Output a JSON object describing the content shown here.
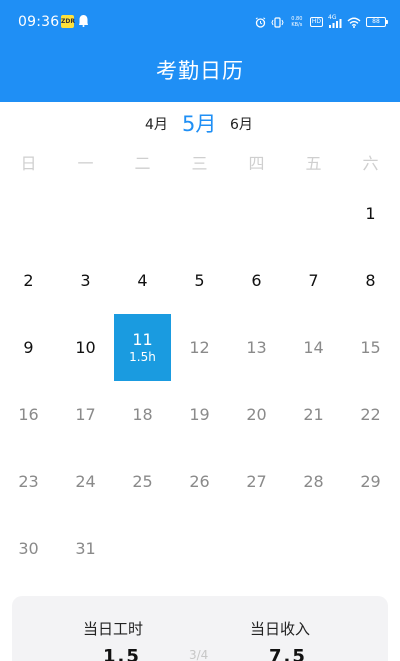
{
  "status_bar": {
    "time": "09:36",
    "notification_badge": "ZDR",
    "net_speed_line1": "0.80",
    "net_speed_line2": "KB/s",
    "hd": "HD",
    "network": "4G",
    "battery": "88"
  },
  "header": {
    "title": "考勤日历"
  },
  "month_nav": {
    "prev": "4月",
    "current": "5月",
    "next": "6月"
  },
  "weekdays": [
    "日",
    "一",
    "二",
    "三",
    "四",
    "五",
    "六"
  ],
  "calendar": {
    "days": [
      {
        "num": "1",
        "state": "past",
        "hours": ""
      },
      {
        "num": "2",
        "state": "past",
        "hours": ""
      },
      {
        "num": "3",
        "state": "past",
        "hours": ""
      },
      {
        "num": "4",
        "state": "past",
        "hours": ""
      },
      {
        "num": "5",
        "state": "past",
        "hours": ""
      },
      {
        "num": "6",
        "state": "past",
        "hours": ""
      },
      {
        "num": "7",
        "state": "past",
        "hours": ""
      },
      {
        "num": "8",
        "state": "past",
        "hours": ""
      },
      {
        "num": "9",
        "state": "past",
        "hours": ""
      },
      {
        "num": "10",
        "state": "past",
        "hours": ""
      },
      {
        "num": "11",
        "state": "selected",
        "hours": "1.5h"
      },
      {
        "num": "12",
        "state": "future",
        "hours": ""
      },
      {
        "num": "13",
        "state": "future",
        "hours": ""
      },
      {
        "num": "14",
        "state": "future",
        "hours": ""
      },
      {
        "num": "15",
        "state": "future",
        "hours": ""
      },
      {
        "num": "16",
        "state": "future",
        "hours": ""
      },
      {
        "num": "17",
        "state": "future",
        "hours": ""
      },
      {
        "num": "18",
        "state": "future",
        "hours": ""
      },
      {
        "num": "19",
        "state": "future",
        "hours": ""
      },
      {
        "num": "20",
        "state": "future",
        "hours": ""
      },
      {
        "num": "21",
        "state": "future",
        "hours": ""
      },
      {
        "num": "22",
        "state": "future",
        "hours": ""
      },
      {
        "num": "23",
        "state": "future",
        "hours": ""
      },
      {
        "num": "24",
        "state": "future",
        "hours": ""
      },
      {
        "num": "25",
        "state": "future",
        "hours": ""
      },
      {
        "num": "26",
        "state": "future",
        "hours": ""
      },
      {
        "num": "27",
        "state": "future",
        "hours": ""
      },
      {
        "num": "28",
        "state": "future",
        "hours": ""
      },
      {
        "num": "29",
        "state": "future",
        "hours": ""
      },
      {
        "num": "30",
        "state": "future",
        "hours": ""
      },
      {
        "num": "31",
        "state": "future",
        "hours": ""
      }
    ]
  },
  "summary": {
    "hours_label": "当日工时",
    "hours_value": "1.5",
    "income_label": "当日收入",
    "income_value": "7.5",
    "page_indicator": "3/4"
  },
  "colors": {
    "primary": "#1f8ff5",
    "selected_day": "#1a9be0"
  }
}
